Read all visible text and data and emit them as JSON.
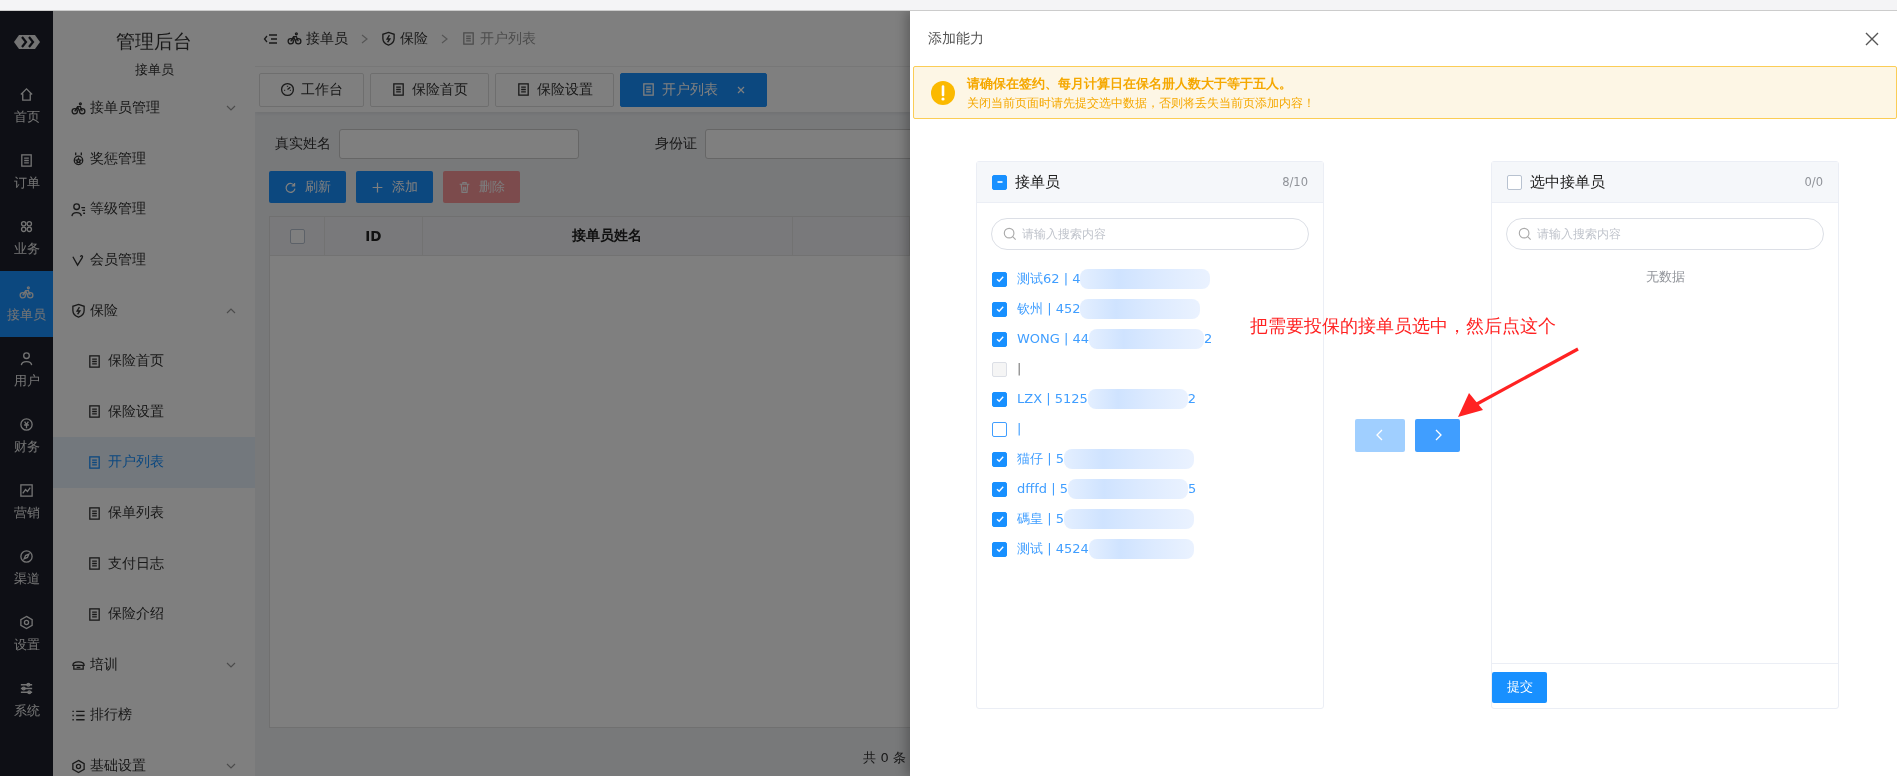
{
  "rail": {
    "items": [
      {
        "label": "首页",
        "selected": false
      },
      {
        "label": "订单",
        "selected": false
      },
      {
        "label": "业务",
        "selected": false
      },
      {
        "label": "接单员",
        "selected": true
      },
      {
        "label": "用户",
        "selected": false
      },
      {
        "label": "财务",
        "selected": false
      },
      {
        "label": "营销",
        "selected": false
      },
      {
        "label": "渠道",
        "selected": false
      },
      {
        "label": "设置",
        "selected": false
      },
      {
        "label": "系统",
        "selected": false
      }
    ]
  },
  "sidebar": {
    "title": "管理后台",
    "subtitle": "接单员",
    "items": [
      {
        "label": "接单员管理",
        "kind": "group",
        "expanded": false
      },
      {
        "label": "奖惩管理",
        "kind": "link"
      },
      {
        "label": "等级管理",
        "kind": "link"
      },
      {
        "label": "会员管理",
        "kind": "link"
      },
      {
        "label": "保险",
        "kind": "group",
        "expanded": true,
        "children": [
          {
            "label": "保险首页",
            "selected": false
          },
          {
            "label": "保险设置",
            "selected": false
          },
          {
            "label": "开户列表",
            "selected": true
          },
          {
            "label": "保单列表",
            "selected": false
          },
          {
            "label": "支付日志",
            "selected": false
          },
          {
            "label": "保险介绍",
            "selected": false
          }
        ]
      },
      {
        "label": "培训",
        "kind": "group",
        "expanded": false
      },
      {
        "label": "排行榜",
        "kind": "link"
      },
      {
        "label": "基础设置",
        "kind": "group",
        "expanded": false
      }
    ]
  },
  "breadcrumb": [
    "接单员",
    "保险",
    "开户列表"
  ],
  "tabs": [
    {
      "label": "工作台",
      "selected": false
    },
    {
      "label": "保险首页",
      "selected": false
    },
    {
      "label": "保险设置",
      "selected": false
    },
    {
      "label": "开户列表",
      "selected": true
    }
  ],
  "filters": [
    {
      "label": "真实姓名"
    },
    {
      "label": "身份证"
    }
  ],
  "toolbar": [
    {
      "label": "刷新",
      "kind": "refresh",
      "disabled": false
    },
    {
      "label": "添加",
      "kind": "add",
      "disabled": false
    },
    {
      "label": "删除",
      "kind": "delete",
      "disabled": true
    }
  ],
  "table": {
    "columns": [
      "ID",
      "接单员姓名"
    ],
    "all_checked": false
  },
  "pagination": {
    "total": "共 0 条"
  },
  "drawer": {
    "title": "添加能力",
    "alert": {
      "title": "请确保在签约、每月计算日在保名册人数大于等于五人。",
      "description": "关闭当前页面时请先提交选中数据，否则将丢失当前页添加内容！"
    },
    "transfer": {
      "left": {
        "title": "接单员",
        "count": "8/10",
        "indeterminate": true,
        "placeholder": "请输入搜索内容",
        "items": [
          {
            "label": "测试62 | 4",
            "checked": true,
            "disabled": false,
            "redacted": true
          },
          {
            "label": "钦州 | 452",
            "checked": true,
            "disabled": false,
            "redacted": true
          },
          {
            "label": "WONG | 44",
            "tail": "2",
            "checked": true,
            "disabled": false,
            "redacted": true
          },
          {
            "label": "|",
            "checked": false,
            "disabled": true,
            "redacted": false
          },
          {
            "label": "LZX | 5125",
            "tail": "2",
            "checked": true,
            "disabled": false,
            "redacted": true
          },
          {
            "label": "|",
            "checked": false,
            "disabled": false,
            "redacted": false
          },
          {
            "label": "猫仔 | 5",
            "checked": true,
            "disabled": false,
            "redacted": true
          },
          {
            "label": "dfffd | 5",
            "tail": "5",
            "checked": true,
            "disabled": false,
            "redacted": true
          },
          {
            "label": "碼皇 | 5",
            "checked": true,
            "disabled": false,
            "redacted": true
          },
          {
            "label": "测试 | 4524",
            "checked": true,
            "disabled": false,
            "redacted": true
          }
        ]
      },
      "right": {
        "title": "选中接单员",
        "count": "0/0",
        "checked": false,
        "indeterminate": false,
        "placeholder": "请输入搜索内容",
        "empty_text": "无数据",
        "submit": "提交"
      },
      "buttons": [
        {
          "kind": "left",
          "disabled": true
        },
        {
          "kind": "right",
          "disabled": false
        }
      ]
    },
    "annotation": {
      "text": "把需要投保的接单员选中，然后点这个"
    }
  }
}
